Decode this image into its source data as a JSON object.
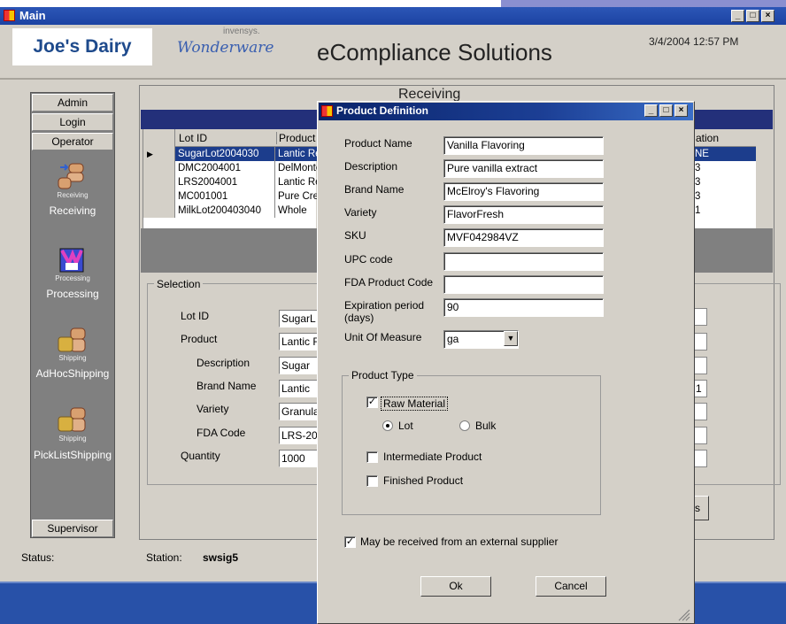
{
  "window": {
    "title": "Main",
    "minimize": "_",
    "maximize": "□",
    "close": "×"
  },
  "header": {
    "logo": "Joe's Dairy",
    "brand_small": "invensys.",
    "brand_script": "Wonderware",
    "app_title": "eCompliance Solutions",
    "datetime": "3/4/2004 12:57 PM"
  },
  "nav": {
    "top_buttons": [
      "Admin",
      "Login",
      "Operator"
    ],
    "items": [
      {
        "icon": "receiving-icon",
        "small": "Receiving",
        "label": "Receiving"
      },
      {
        "icon": "processing-icon",
        "small": "Processing",
        "label": "Processing"
      },
      {
        "icon": "shipping-icon",
        "small": "Shipping",
        "label": "AdHocShipping"
      },
      {
        "icon": "shipping-icon",
        "small": "Shipping",
        "label": "PickListShipping"
      }
    ],
    "bottom_button": "Supervisor"
  },
  "receiving": {
    "title": "Receiving",
    "columns": [
      "Lot ID",
      "Product"
    ],
    "rows": [
      {
        "lot": "SugarLot2004030",
        "product": "Lantic Re",
        "selected": true
      },
      {
        "lot": "DMC2004001",
        "product": "DelMonte"
      },
      {
        "lot": "LRS2004001",
        "product": "Lantic Re"
      },
      {
        "lot": "MC001001",
        "product": "Pure Cre"
      },
      {
        "lot": "MilkLot200403040",
        "product": "Whole"
      }
    ],
    "right_column": "ation",
    "right_cells": [
      "NE",
      "3",
      "3",
      "3",
      "1"
    ],
    "selection_label": "Selection",
    "selection_fields": [
      {
        "label": "Lot ID",
        "value": "SugarL"
      },
      {
        "label": "Product",
        "value": "Lantic F"
      },
      {
        "label": "Description",
        "value": "Sugar"
      },
      {
        "label": "Brand Name",
        "value": "Lantic"
      },
      {
        "label": "Variety",
        "value": "Granula"
      },
      {
        "label": "FDA Code",
        "value": "LRS-20"
      },
      {
        "label": "Quantity",
        "value": "1000"
      }
    ],
    "right_box_value": "1",
    "partial_button": "s"
  },
  "status": {
    "status_label": "Status:",
    "station_label": "Station:",
    "station_value": "swsig5"
  },
  "dialog": {
    "title": "Product Definition",
    "fields": [
      {
        "label": "Product Name",
        "value": "Vanilla Flavoring"
      },
      {
        "label": "Description",
        "value": "Pure vanilla extract"
      },
      {
        "label": "Brand Name",
        "value": "McElroy's Flavoring"
      },
      {
        "label": "Variety",
        "value": "FlavorFresh"
      },
      {
        "label": "SKU",
        "value": "MVF042984VZ"
      },
      {
        "label": "UPC code",
        "value": ""
      },
      {
        "label": "FDA Product Code",
        "value": ""
      }
    ],
    "expiration_label_1": "Expiration period",
    "expiration_label_2": "(days)",
    "expiration_value": "90",
    "uom_label": "Unit Of Measure",
    "uom_value": "ga",
    "product_type_label": "Product Type",
    "raw_material": "Raw Material",
    "raw_material_checked": true,
    "lot": "Lot",
    "lot_selected": true,
    "bulk": "Bulk",
    "intermediate": "Intermediate Product",
    "finished": "Finished Product",
    "external_supplier": "May be received from an external supplier",
    "external_supplier_checked": true,
    "ok": "Ok",
    "cancel": "Cancel"
  }
}
